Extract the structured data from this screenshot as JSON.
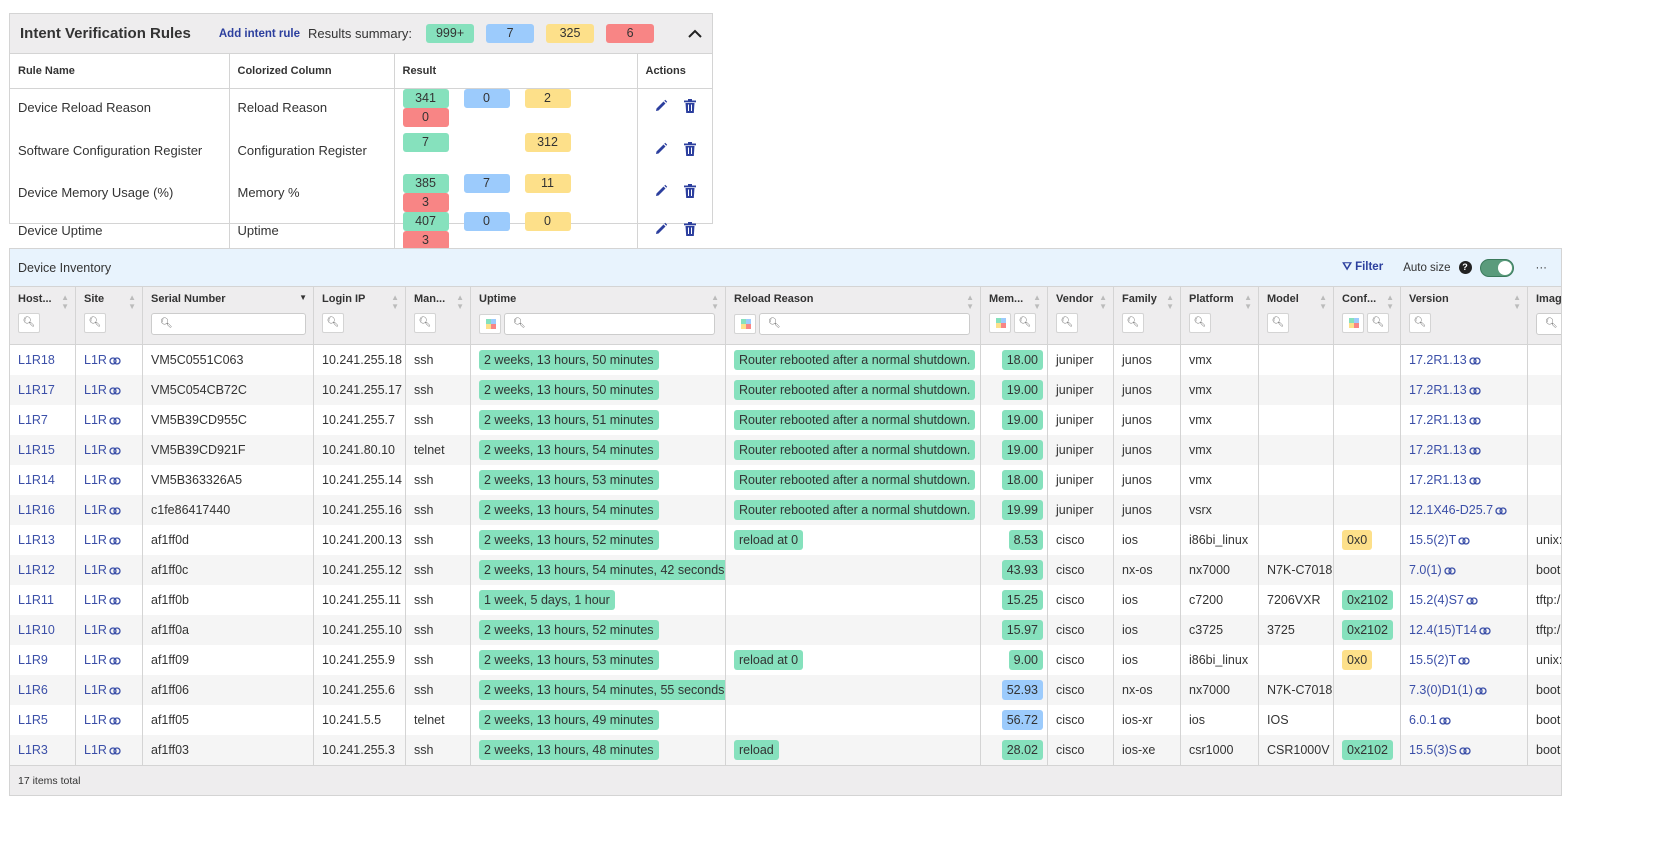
{
  "colors": {
    "green": "#86e1bd",
    "blue": "#9ccbfc",
    "yellow": "#fde08a",
    "red": "#f88585",
    "link": "#3b4fa8"
  },
  "rules_panel": {
    "title": "Intent Verification Rules",
    "add_label": "Add intent rule",
    "summary_label": "Results summary:",
    "summary": [
      "999+",
      "7",
      "325",
      "6"
    ],
    "collapse_icon": "chevron-up-icon",
    "columns": [
      "Rule Name",
      "Colorized Column",
      "Result",
      "Actions"
    ],
    "rows": [
      {
        "name": "Device Reload Reason",
        "column": "Reload Reason",
        "results": [
          "341",
          "0",
          "2",
          "0"
        ]
      },
      {
        "name": "Software Configuration Register",
        "column": "Configuration Register",
        "results": [
          "7",
          "",
          "312",
          ""
        ]
      },
      {
        "name": "Device Memory Usage (%)",
        "column": "Memory %",
        "results": [
          "385",
          "7",
          "11",
          "3"
        ]
      },
      {
        "name": "Device Uptime",
        "column": "Uptime",
        "results": [
          "407",
          "0",
          "0",
          "3"
        ]
      }
    ]
  },
  "inventory": {
    "title": "Device Inventory",
    "filter_label": "Filter",
    "autosize_label": "Auto size",
    "autosize_on": true,
    "more_label": "···",
    "footer": "17 items total",
    "columns": [
      {
        "label": "Host...",
        "search": "btn"
      },
      {
        "label": "Site",
        "search": "btn"
      },
      {
        "label": "Serial Number",
        "search": "input",
        "sorted": "desc"
      },
      {
        "label": "Login IP",
        "search": "btn"
      },
      {
        "label": "Man...",
        "search": "btn"
      },
      {
        "label": "Uptime",
        "search": "input",
        "colorize": true
      },
      {
        "label": "Reload Reason",
        "search": "input",
        "colorize": true
      },
      {
        "label": "Mem...",
        "search": "btn",
        "colorize": true
      },
      {
        "label": "Vendor",
        "search": "btn"
      },
      {
        "label": "Family",
        "search": "btn"
      },
      {
        "label": "Platform",
        "search": "btn"
      },
      {
        "label": "Model",
        "search": "btn"
      },
      {
        "label": "Conf...",
        "search": "btn",
        "colorize": true
      },
      {
        "label": "Version",
        "search": "btn"
      },
      {
        "label": "Image",
        "search": "input"
      }
    ],
    "rows": [
      [
        "L1R18",
        "L1R",
        "VM5C0551C063",
        "10.241.255.18",
        "ssh",
        "2 weeks, 13 hours, 50 minutes",
        "Router rebooted after a normal shutdown.",
        "18.00",
        "juniper",
        "junos",
        "vmx",
        "",
        "",
        "17.2R1.13",
        ""
      ],
      [
        "L1R17",
        "L1R",
        "VM5C054CB72C",
        "10.241.255.17",
        "ssh",
        "2 weeks, 13 hours, 50 minutes",
        "Router rebooted after a normal shutdown.",
        "19.00",
        "juniper",
        "junos",
        "vmx",
        "",
        "",
        "17.2R1.13",
        ""
      ],
      [
        "L1R7",
        "L1R",
        "VM5B39CD955C",
        "10.241.255.7",
        "ssh",
        "2 weeks, 13 hours, 51 minutes",
        "Router rebooted after a normal shutdown.",
        "19.00",
        "juniper",
        "junos",
        "vmx",
        "",
        "",
        "17.2R1.13",
        ""
      ],
      [
        "L1R15",
        "L1R",
        "VM5B39CD921F",
        "10.241.80.10",
        "telnet",
        "2 weeks, 13 hours, 54 minutes",
        "Router rebooted after a normal shutdown.",
        "19.00",
        "juniper",
        "junos",
        "vmx",
        "",
        "",
        "17.2R1.13",
        ""
      ],
      [
        "L1R14",
        "L1R",
        "VM5B363326A5",
        "10.241.255.14",
        "ssh",
        "2 weeks, 13 hours, 53 minutes",
        "Router rebooted after a normal shutdown.",
        "18.00",
        "juniper",
        "junos",
        "vmx",
        "",
        "",
        "17.2R1.13",
        ""
      ],
      [
        "L1R16",
        "L1R",
        "c1fe86417440",
        "10.241.255.16",
        "ssh",
        "2 weeks, 13 hours, 54 minutes",
        "Router rebooted after a normal shutdown.",
        "19.99",
        "juniper",
        "junos",
        "vsrx",
        "",
        "",
        "12.1X46-D25.7",
        ""
      ],
      [
        "L1R13",
        "L1R",
        "af1ff0d",
        "10.241.200.13",
        "ssh",
        "2 weeks, 13 hours, 52 minutes",
        "reload at 0",
        "8.53",
        "cisco",
        "ios",
        "i86bi_linux",
        "",
        "0x0",
        "15.5(2)T",
        "unix:"
      ],
      [
        "L1R12",
        "L1R",
        "af1ff0c",
        "10.241.255.12",
        "ssh",
        "2 weeks, 13 hours, 54 minutes, 42 seconds",
        "",
        "43.93",
        "cisco",
        "nx-os",
        "nx7000",
        "N7K-C7018",
        "",
        "7.0(1)",
        "boot"
      ],
      [
        "L1R11",
        "L1R",
        "af1ff0b",
        "10.241.255.11",
        "ssh",
        "1 week, 5 days, 1 hour",
        "",
        "15.25",
        "cisco",
        "ios",
        "c7200",
        "7206VXR",
        "0x2102",
        "15.2(4)S7",
        "tftp:/"
      ],
      [
        "L1R10",
        "L1R",
        "af1ff0a",
        "10.241.255.10",
        "ssh",
        "2 weeks, 13 hours, 52 minutes",
        "",
        "15.97",
        "cisco",
        "ios",
        "c3725",
        "3725",
        "0x2102",
        "12.4(15)T14",
        "tftp:/"
      ],
      [
        "L1R9",
        "L1R",
        "af1ff09",
        "10.241.255.9",
        "ssh",
        "2 weeks, 13 hours, 53 minutes",
        "reload at 0",
        "9.00",
        "cisco",
        "ios",
        "i86bi_linux",
        "",
        "0x0",
        "15.5(2)T",
        "unix:"
      ],
      [
        "L1R6",
        "L1R",
        "af1ff06",
        "10.241.255.6",
        "ssh",
        "2 weeks, 13 hours, 54 minutes, 55 seconds",
        "",
        "52.93",
        "cisco",
        "nx-os",
        "nx7000",
        "N7K-C7018",
        "",
        "7.3(0)D1(1)",
        "boot"
      ],
      [
        "L1R5",
        "L1R",
        "af1ff05",
        "10.241.5.5",
        "telnet",
        "2 weeks, 13 hours, 49 minutes",
        "",
        "56.72",
        "cisco",
        "ios-xr",
        "ios",
        "IOS",
        "",
        "6.0.1",
        "boot"
      ],
      [
        "L1R3",
        "L1R",
        "af1ff03",
        "10.241.255.3",
        "ssh",
        "2 weeks, 13 hours, 48 minutes",
        "reload",
        "28.02",
        "cisco",
        "ios-xe",
        "csr1000",
        "CSR1000V",
        "0x2102",
        "15.5(3)S",
        "boot"
      ]
    ],
    "mem_status": [
      "green",
      "green",
      "green",
      "green",
      "green",
      "green",
      "green",
      "green",
      "green",
      "green",
      "green",
      "blue",
      "blue",
      "green"
    ],
    "conf_status": {
      "0x0": "yellow",
      "0x2102": "green"
    }
  }
}
